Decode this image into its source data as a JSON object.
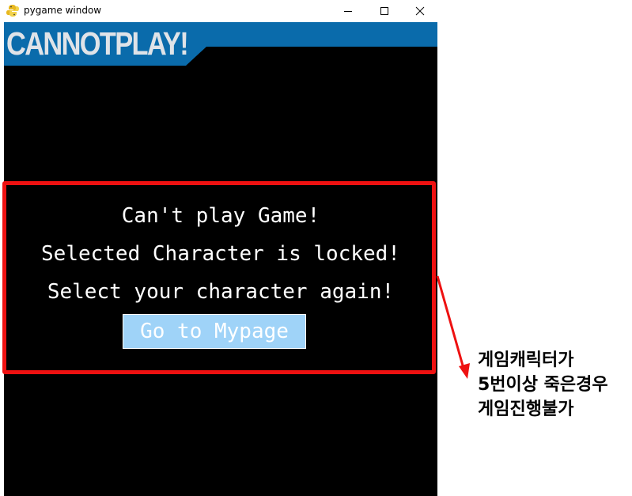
{
  "window": {
    "title": "pygame window",
    "icon": "pygame-snake-icon",
    "controls": [
      "minimize-icon",
      "maximize-icon",
      "close-icon"
    ]
  },
  "game": {
    "banner_text": "CANNOTPLAY!",
    "banner_color": "#0a6bab",
    "background_color": "#000000",
    "messages": [
      "Can't play Game!",
      "Selected Character is locked!",
      "Select your character again!"
    ],
    "mypage_button_label": "Go to Mypage",
    "button_color": "#9fd3f8"
  },
  "annotation": {
    "box_color": "#ee1111",
    "lines": [
      "게임캐릭터가",
      "5번이상 죽은경우",
      "게임진행불가"
    ]
  }
}
